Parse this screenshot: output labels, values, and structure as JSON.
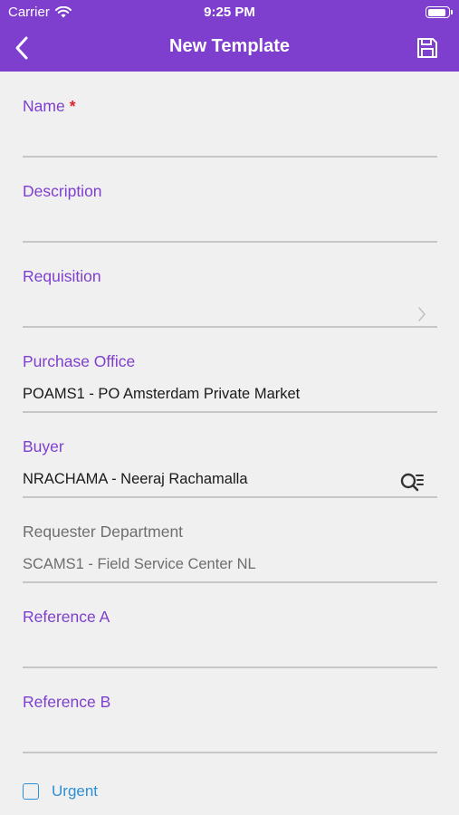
{
  "status_bar": {
    "carrier": "Carrier",
    "time": "9:25 PM"
  },
  "nav": {
    "title": "New Template"
  },
  "fields": {
    "name": {
      "label": "Name",
      "required_mark": "*",
      "value": ""
    },
    "description": {
      "label": "Description",
      "value": ""
    },
    "requisition": {
      "label": "Requisition",
      "value": ""
    },
    "purchase_office": {
      "label": "Purchase Office",
      "value": "POAMS1  -  PO Amsterdam Private Market"
    },
    "buyer": {
      "label": "Buyer",
      "value": "NRACHAMA  -  Neeraj Rachamalla"
    },
    "requester_department": {
      "label": "Requester Department",
      "value": "SCAMS1  -  Field Service Center NL"
    },
    "reference_a": {
      "label": "Reference A",
      "value": ""
    },
    "reference_b": {
      "label": "Reference B",
      "value": ""
    }
  },
  "urgent": {
    "label": "Urgent",
    "checked": false
  },
  "colors": {
    "accent": "#7f3fce",
    "required": "#e0242e",
    "link": "#2d8fd5",
    "disabled_text": "#6e6e6e"
  },
  "icons": [
    "wifi-icon",
    "battery-icon",
    "back-chevron-icon",
    "save-icon",
    "chevron-right-icon",
    "search-list-icon"
  ]
}
